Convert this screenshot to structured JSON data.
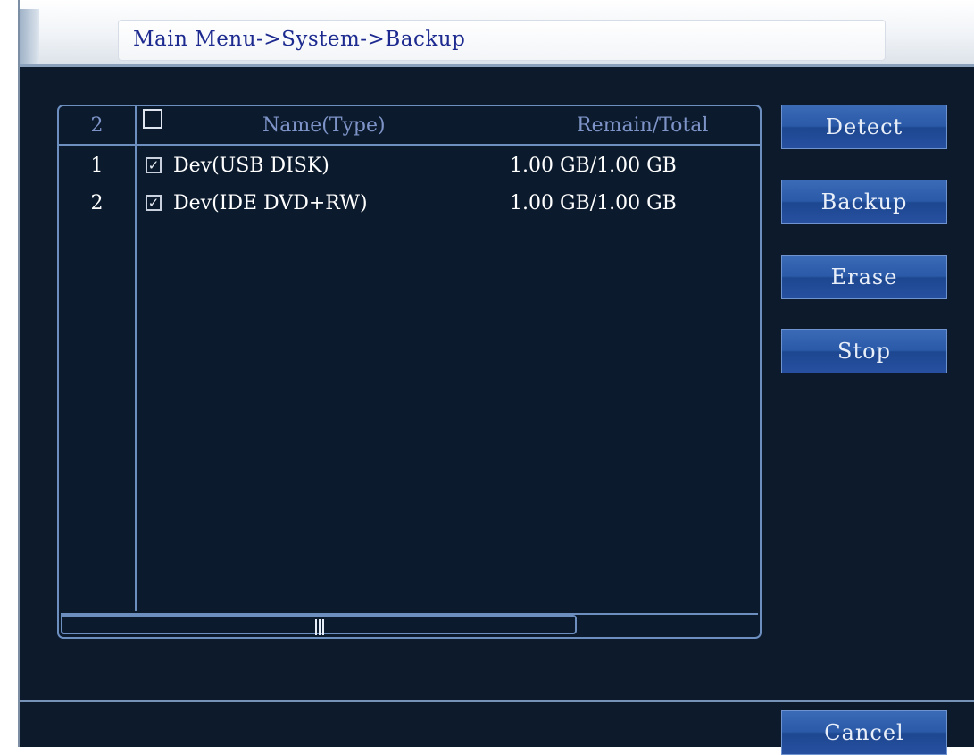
{
  "title": "Main Menu->System->Backup",
  "list": {
    "header": {
      "count": "2",
      "name_label": "Name(Type)",
      "remain_label": "Remain/Total"
    },
    "rows": [
      {
        "index": "1",
        "checked": "✓",
        "name": "Dev(USB DISK)",
        "remain": "1.00 GB/1.00 GB"
      },
      {
        "index": "2",
        "checked": "✓",
        "name": "Dev(IDE DVD+RW)",
        "remain": "1.00 GB/1.00 GB"
      }
    ],
    "scroll_position": 0.74
  },
  "buttons": {
    "detect": "Detect",
    "backup": "Backup",
    "erase": "Erase",
    "stop": "Stop",
    "cancel": "Cancel"
  },
  "colors": {
    "background": "#0c1a2c",
    "panel_border": "#6d8fc0",
    "button": "#2a5aa8",
    "title_text": "#1d2a8f"
  },
  "icons": [
    "checkbox-icon",
    "scroll-grip-icon"
  ]
}
